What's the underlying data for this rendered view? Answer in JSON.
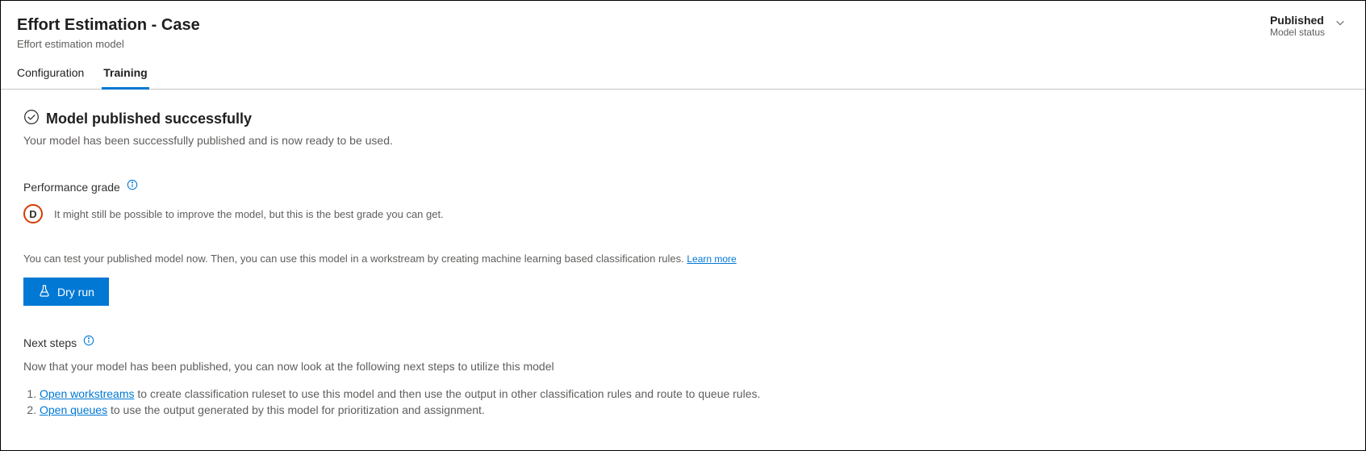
{
  "header": {
    "title": "Effort Estimation - Case",
    "subtitle": "Effort estimation model",
    "status_value": "Published",
    "status_label": "Model status"
  },
  "tabs": {
    "configuration": "Configuration",
    "training": "Training",
    "active": "training"
  },
  "success": {
    "title": "Model published successfully",
    "desc": "Your model has been successfully published and is now ready to be used."
  },
  "performance": {
    "label": "Performance grade",
    "grade_letter": "D",
    "grade_text": "It might still be possible to improve the model, but this is the best grade you can get."
  },
  "test": {
    "text": "You can test your published model now. Then, you can use this model in a workstream by creating machine learning based classification rules. ",
    "learn_more": "Learn more"
  },
  "dry_run_label": "Dry run",
  "next_steps": {
    "label": "Next steps",
    "desc": "Now that your model has been published, you can now look at the following next steps to utilize this model",
    "items": [
      {
        "link": "Open workstreams",
        "rest": " to create classification ruleset to use this model and then use the output in other classification rules and route to queue rules."
      },
      {
        "link": "Open queues",
        "rest": " to use the output generated by this model for prioritization and assignment."
      }
    ]
  }
}
